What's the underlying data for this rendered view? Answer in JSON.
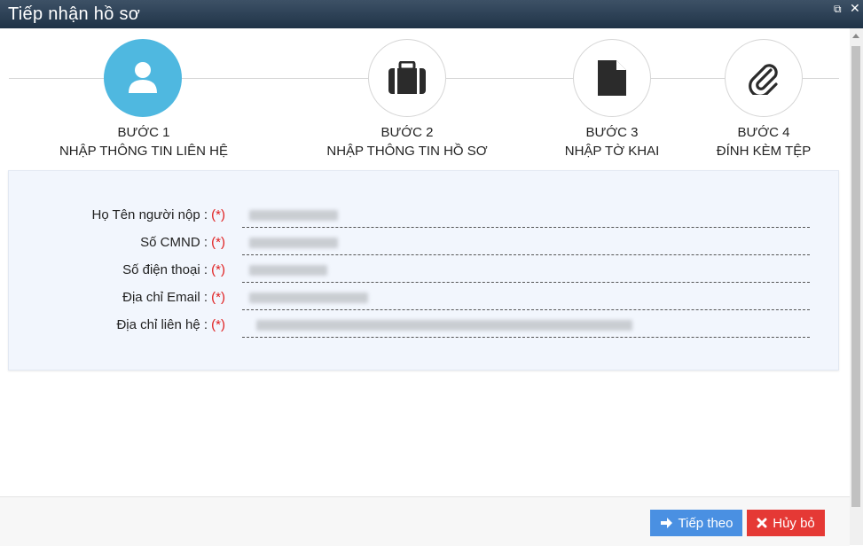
{
  "window": {
    "title": "Tiếp nhận hồ sơ",
    "restore_icon": "restore-icon",
    "close_icon": "close-icon"
  },
  "steps": [
    {
      "number_label": "BƯỚC 1",
      "name": "NHẬP THÔNG TIN LIÊN HỆ",
      "icon": "user-icon",
      "active": true
    },
    {
      "number_label": "BƯỚC 2",
      "name": "NHẬP THÔNG TIN HỒ SƠ",
      "icon": "briefcase-icon",
      "active": false
    },
    {
      "number_label": "BƯỚC 3",
      "name": "NHẬP TỜ KHAI",
      "icon": "document-icon",
      "active": false
    },
    {
      "number_label": "BƯỚC 4",
      "name": "ĐÍNH KÈM TỆP",
      "icon": "paperclip-icon",
      "active": false
    }
  ],
  "form": {
    "required_marker": "(*)",
    "fields": [
      {
        "label": "Họ Tên người nộp :",
        "value_hidden": true
      },
      {
        "label": "Số CMND :",
        "value_hidden": true
      },
      {
        "label": "Số điện thoại :",
        "value_hidden": true
      },
      {
        "label": "Địa chỉ Email :",
        "value_hidden": true
      },
      {
        "label": "Địa chỉ liên hệ :",
        "value_hidden": true
      }
    ]
  },
  "footer": {
    "next_label": "Tiếp theo",
    "cancel_label": "Hủy bỏ"
  },
  "colors": {
    "active_step": "#4fb8e0",
    "next_button": "#4a90e2",
    "cancel_button": "#e53935",
    "required": "#e02020",
    "titlebar": "#2b3e52"
  }
}
